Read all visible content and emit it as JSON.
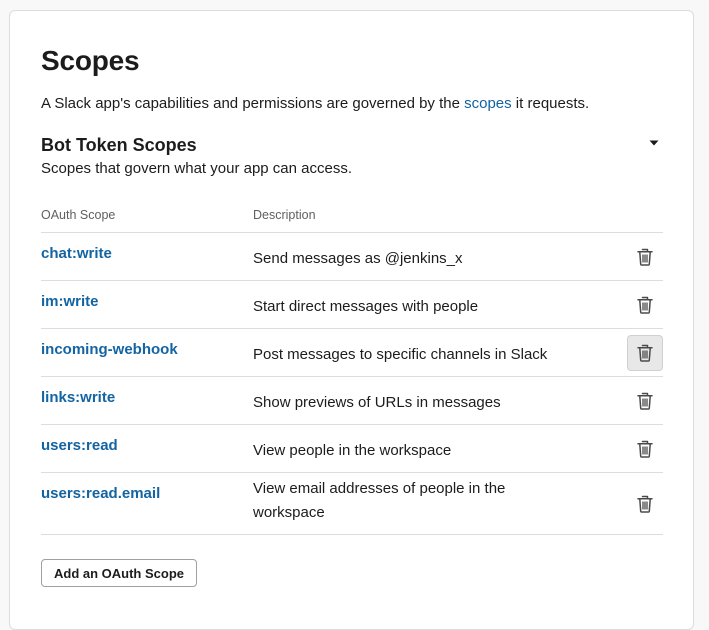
{
  "header": {
    "title": "Scopes",
    "intro_before": "A Slack app's capabilities and permissions are governed by the ",
    "intro_link": "scopes",
    "intro_after": " it requests."
  },
  "bot_section": {
    "title": "Bot Token Scopes",
    "subtitle": "Scopes that govern what your app can access.",
    "expanded": true
  },
  "table": {
    "columns": [
      "OAuth Scope",
      "Description"
    ],
    "rows": [
      {
        "scope": "chat:write",
        "description": "Send messages as @jenkins_x"
      },
      {
        "scope": "im:write",
        "description": "Start direct messages with people"
      },
      {
        "scope": "incoming-webhook",
        "description": "Post messages to specific channels in Slack"
      },
      {
        "scope": "links:write",
        "description": "Show previews of URLs in messages"
      },
      {
        "scope": "users:read",
        "description": "View people in the workspace"
      },
      {
        "scope": "users:read.email",
        "description": "View email addresses of people in the workspace"
      }
    ],
    "hovered_row": 2
  },
  "actions": {
    "add_scope_label": "Add an OAuth Scope"
  },
  "icons": {
    "row_action": "trash-icon",
    "toggle": "caret-down-icon"
  },
  "colors": {
    "link": "#1264a3",
    "text": "#1d1c1d",
    "muted": "#616061",
    "divider": "#dddddd"
  }
}
